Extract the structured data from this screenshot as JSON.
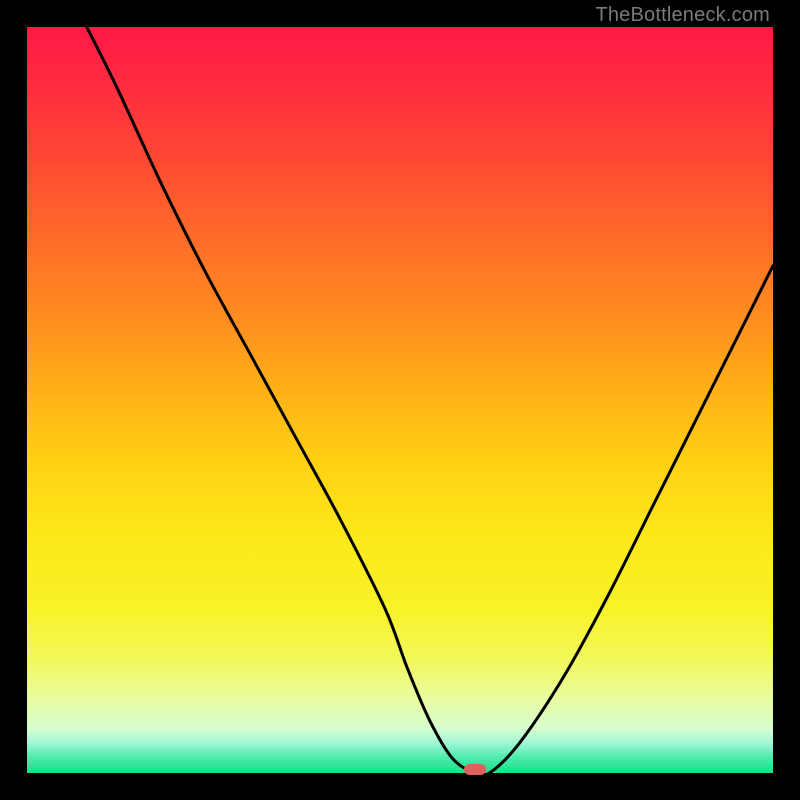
{
  "watermark": "TheBottleneck.com",
  "chart_data": {
    "type": "line",
    "title": "",
    "xlabel": "",
    "ylabel": "",
    "xlim": [
      0,
      100
    ],
    "ylim": [
      0,
      100
    ],
    "grid": false,
    "legend": false,
    "series": [
      {
        "name": "bottleneck-curve",
        "x": [
          8,
          12,
          18,
          24,
          30,
          36,
          42,
          48,
          51,
          54,
          57,
          60,
          62,
          66,
          72,
          78,
          84,
          90,
          96,
          100
        ],
        "values": [
          100,
          92,
          79,
          67,
          56,
          45,
          34,
          22,
          14,
          7,
          2,
          0,
          0,
          4,
          13,
          24,
          36,
          48,
          60,
          68
        ]
      }
    ],
    "marker": {
      "x": 60,
      "y": 0
    },
    "background": "red-green-vertical-gradient"
  }
}
